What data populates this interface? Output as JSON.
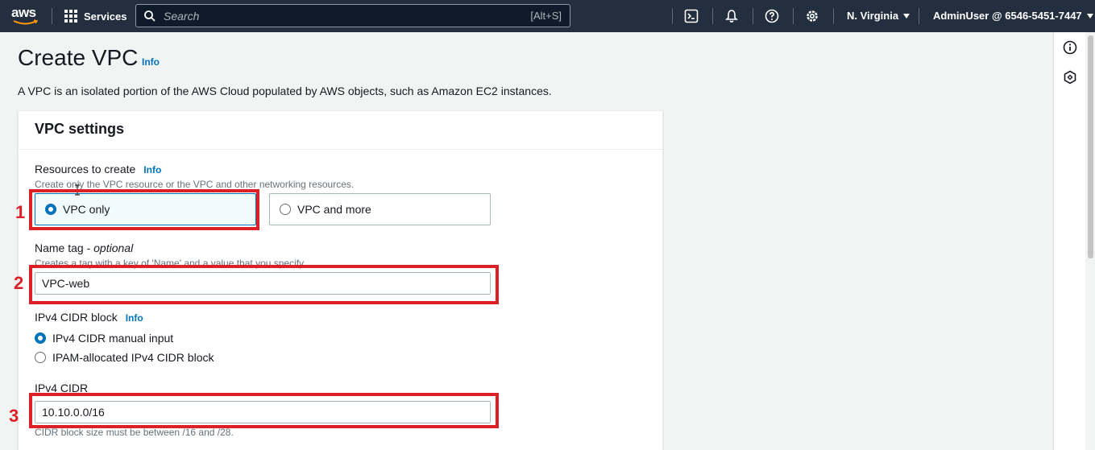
{
  "topnav": {
    "logo_text": "aws",
    "services_label": "Services",
    "search_placeholder": "Search",
    "search_shortcut": "[Alt+S]",
    "region_label": "N. Virginia",
    "account_label": "AdminUser @ 6546-5451-7447"
  },
  "page": {
    "title": "Create VPC",
    "title_info": "Info",
    "description": "A VPC is an isolated portion of the AWS Cloud populated by AWS objects, such as Amazon EC2 instances."
  },
  "panel": {
    "title": "VPC settings",
    "resources": {
      "label": "Resources to create",
      "info": "Info",
      "hint": "Create only the VPC resource or the VPC and other networking resources.",
      "options": [
        {
          "label": "VPC only",
          "selected": true
        },
        {
          "label": "VPC and more",
          "selected": false
        }
      ]
    },
    "name_tag": {
      "label": "Name tag - ",
      "label_optional": "optional",
      "hint": "Creates a tag with a key of 'Name' and a value that you specify.",
      "value": "VPC-web"
    },
    "ipv4_block": {
      "label": "IPv4 CIDR block",
      "info": "Info",
      "options": [
        {
          "label": "IPv4 CIDR manual input",
          "selected": true
        },
        {
          "label": "IPAM-allocated IPv4 CIDR block",
          "selected": false
        }
      ]
    },
    "ipv4_cidr": {
      "label": "IPv4 CIDR",
      "value": "10.10.0.0/16",
      "hint": "CIDR block size must be between /16 and /28."
    }
  },
  "annotations": [
    "1",
    "2",
    "3"
  ],
  "colors": {
    "nav_bg": "#232f3e",
    "link": "#0073bb",
    "annotation": "#dd1f26",
    "selected_bg": "#f1faff"
  }
}
